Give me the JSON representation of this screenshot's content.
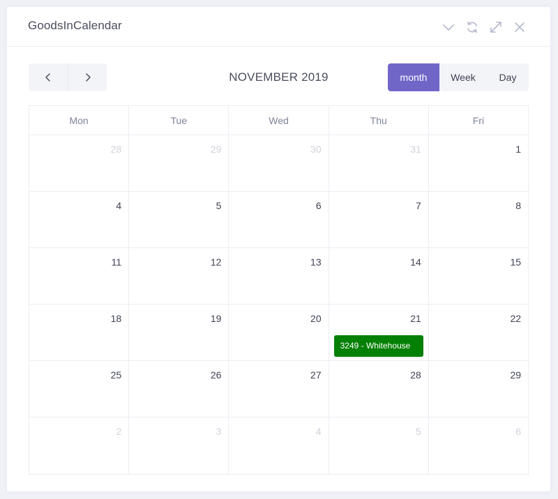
{
  "panel": {
    "title": "GoodsInCalendar",
    "tools": [
      {
        "name": "collapse-icon",
        "icon": "chevron-down"
      },
      {
        "name": "refresh-icon",
        "icon": "refresh"
      },
      {
        "name": "fullscreen-icon",
        "icon": "expand"
      },
      {
        "name": "close-icon",
        "icon": "close"
      }
    ]
  },
  "toolbar": {
    "prev_icon": "chevron-left",
    "next_icon": "chevron-right",
    "title": "NOVEMBER 2019",
    "views": [
      {
        "label": "month",
        "active": true
      },
      {
        "label": "Week",
        "active": false
      },
      {
        "label": "Day",
        "active": false
      }
    ]
  },
  "calendar": {
    "weekdays": [
      "Mon",
      "Tue",
      "Wed",
      "Thu",
      "Fri"
    ],
    "weeks": [
      [
        {
          "day": "28",
          "other": true
        },
        {
          "day": "29",
          "other": true
        },
        {
          "day": "30",
          "other": true
        },
        {
          "day": "31",
          "other": true
        },
        {
          "day": "1",
          "other": false
        }
      ],
      [
        {
          "day": "4",
          "other": false
        },
        {
          "day": "5",
          "other": false
        },
        {
          "day": "6",
          "other": false
        },
        {
          "day": "7",
          "other": false
        },
        {
          "day": "8",
          "other": false
        }
      ],
      [
        {
          "day": "11",
          "other": false
        },
        {
          "day": "12",
          "other": false
        },
        {
          "day": "13",
          "other": false
        },
        {
          "day": "14",
          "other": false
        },
        {
          "day": "15",
          "other": false
        }
      ],
      [
        {
          "day": "18",
          "other": false
        },
        {
          "day": "19",
          "other": false
        },
        {
          "day": "20",
          "other": false
        },
        {
          "day": "21",
          "other": false,
          "event": "3249 - Whitehouse"
        },
        {
          "day": "22",
          "other": false
        }
      ],
      [
        {
          "day": "25",
          "other": false
        },
        {
          "day": "26",
          "other": false
        },
        {
          "day": "27",
          "other": false
        },
        {
          "day": "28",
          "other": false
        },
        {
          "day": "29",
          "other": false
        }
      ],
      [
        {
          "day": "2",
          "other": true
        },
        {
          "day": "3",
          "other": true
        },
        {
          "day": "4",
          "other": true
        },
        {
          "day": "5",
          "other": true
        },
        {
          "day": "6",
          "other": true
        }
      ]
    ]
  },
  "colors": {
    "accent": "#7066c8",
    "event": "#048004",
    "muted_day": "#d0d2dc",
    "border": "#ebedf3"
  }
}
